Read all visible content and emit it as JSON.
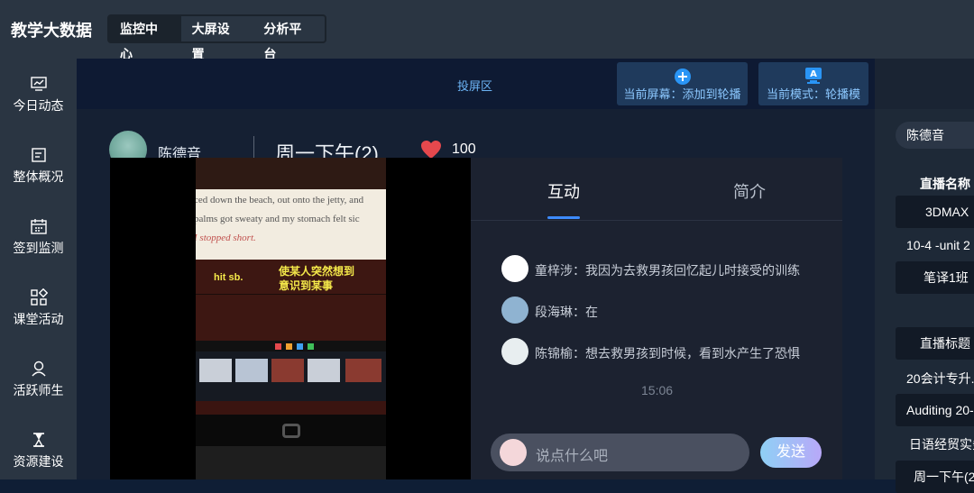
{
  "app": {
    "title": "教学大数据"
  },
  "top_tabs": [
    {
      "label": "监控中心",
      "active": true
    },
    {
      "label": "大屏设置",
      "active": false
    },
    {
      "label": "分析平台",
      "active": false
    }
  ],
  "sidebar": {
    "items": [
      {
        "label": "今日动态",
        "icon": "monitor-chart-icon"
      },
      {
        "label": "整体概况",
        "icon": "document-icon"
      },
      {
        "label": "签到监测",
        "icon": "calendar-icon"
      },
      {
        "label": "课堂活动",
        "icon": "grid-icon"
      },
      {
        "label": "活跃师生",
        "icon": "user-icon"
      },
      {
        "label": "资源建设",
        "icon": "hourglass-icon"
      }
    ]
  },
  "projection": {
    "label": "投屏区",
    "btn_add": "当前屏幕：添加到轮播",
    "btn_mode": "当前模式：轮播模"
  },
  "stream": {
    "teacher": "陈德音",
    "title": "周一下午(2)",
    "likes": "100"
  },
  "video": {
    "text_line1": "ced down the beach, out onto the jetty, and",
    "text_line2": "palms got sweaty and my stomach felt sic",
    "text_line3": "I stopped short.",
    "note1": "hit sb.",
    "note2": "使某人突然想到",
    "note3": "意识到某事"
  },
  "chat": {
    "tab_interact": "互动",
    "tab_intro": "简介",
    "messages": [
      {
        "text": "童梓涉：我因为去救男孩回忆起儿时接受的训练"
      },
      {
        "text": "段海琳：在"
      },
      {
        "text": "陈锦榆：想去救男孩到时候，看到水产生了恐惧"
      }
    ],
    "time": "15:06",
    "input_placeholder": "说点什么吧",
    "send_label": "发送"
  },
  "right_panel": {
    "teacher_pill": "陈德音",
    "live_name_label": "直播名称",
    "names": [
      "3DMAX",
      "10-4 -unit 2",
      "笔译1班"
    ],
    "live_title_label": "直播标题",
    "titles": [
      "20会计专升.",
      "Auditing 20-",
      "日语经贸实务",
      "周一下午(2"
    ]
  },
  "colors": {
    "accent": "#3d8bff",
    "heart": "#e5484d",
    "send_from": "#8fd0f5",
    "send_to": "#b8a8f8"
  }
}
